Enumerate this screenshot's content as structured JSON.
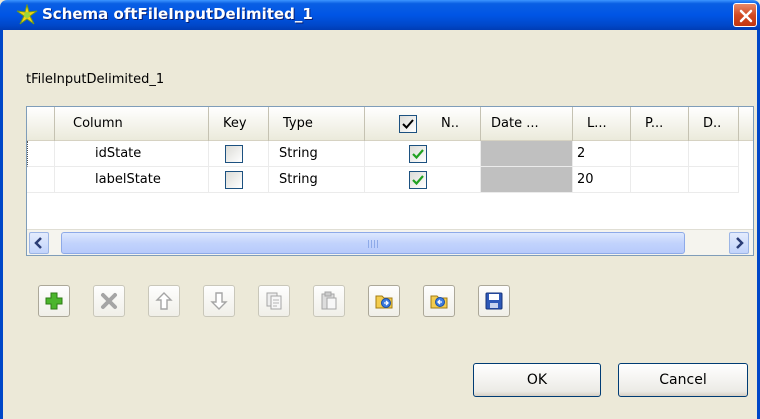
{
  "window": {
    "title": "Schema oftFileInputDelimited_1",
    "close_label": "×"
  },
  "component_label": "tFileInputDelimited_1",
  "table": {
    "headers": {
      "column": "Column",
      "key": "Key",
      "type": "Type",
      "nullable": "N..",
      "date_pattern": "Date ...",
      "length": "L...",
      "precision": "P...",
      "default": "D.."
    },
    "rows": [
      {
        "column": "idState",
        "key": false,
        "type": "String",
        "nullable": true,
        "length": "2"
      },
      {
        "column": "labelState",
        "key": false,
        "type": "String",
        "nullable": true,
        "length": "20"
      }
    ]
  },
  "toolbar": {
    "icons": [
      "add-icon",
      "remove-icon",
      "move-up-icon",
      "move-down-icon",
      "copy-icon",
      "paste-icon",
      "import-icon",
      "export-icon",
      "save-icon"
    ]
  },
  "buttons": {
    "ok": "OK",
    "cancel": "Cancel"
  },
  "colors": {
    "title_bar": "#0055e5",
    "close_button": "#d24a22",
    "dialog_bg": "#ece9d8",
    "check_green": "#21a121"
  }
}
